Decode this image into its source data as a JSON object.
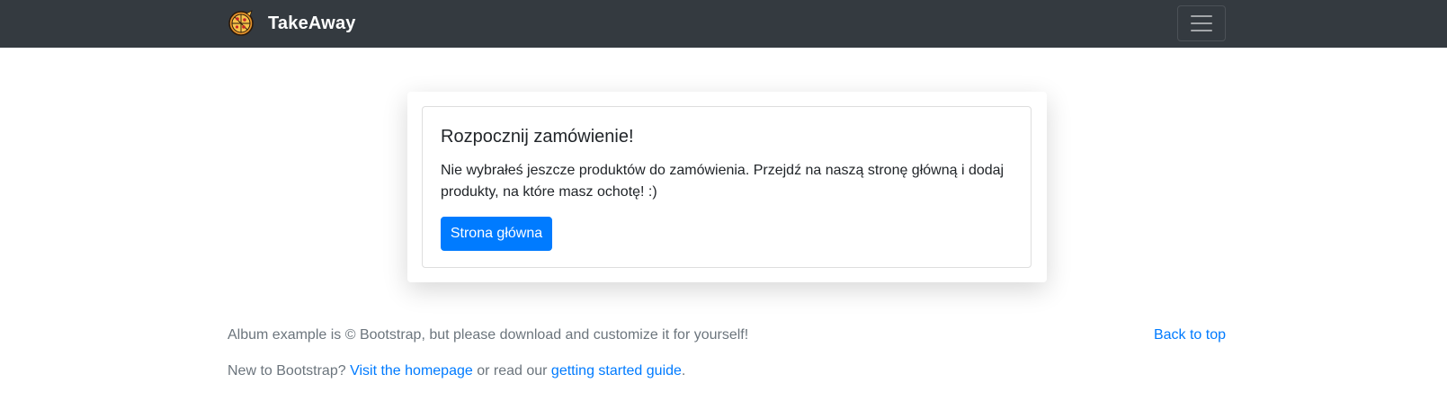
{
  "header": {
    "brand_name": "TakeAway",
    "logo_icon": "pizza-icon",
    "menu_icon": "hamburger-menu-icon",
    "background_color": "#343a40"
  },
  "card": {
    "title": "Rozpocznij zamówienie!",
    "text": "Nie wybrałeś jeszcze produktów do zamówienia. Przejdź na naszą stronę główną i dodaj produkty, na które masz ochotę! :)",
    "button_label": "Strona główna",
    "button_color": "#007bff"
  },
  "footer": {
    "line1": "Album example is © Bootstrap, but please download and customize it for yourself!",
    "back_to_top": "Back to top",
    "line2_prefix": "New to Bootstrap? ",
    "homepage_link": "Visit the homepage",
    "line2_middle": " or read our ",
    "guide_link": "getting started guide",
    "line2_suffix": ".",
    "text_color": "#6c757d",
    "link_color": "#007bff"
  }
}
